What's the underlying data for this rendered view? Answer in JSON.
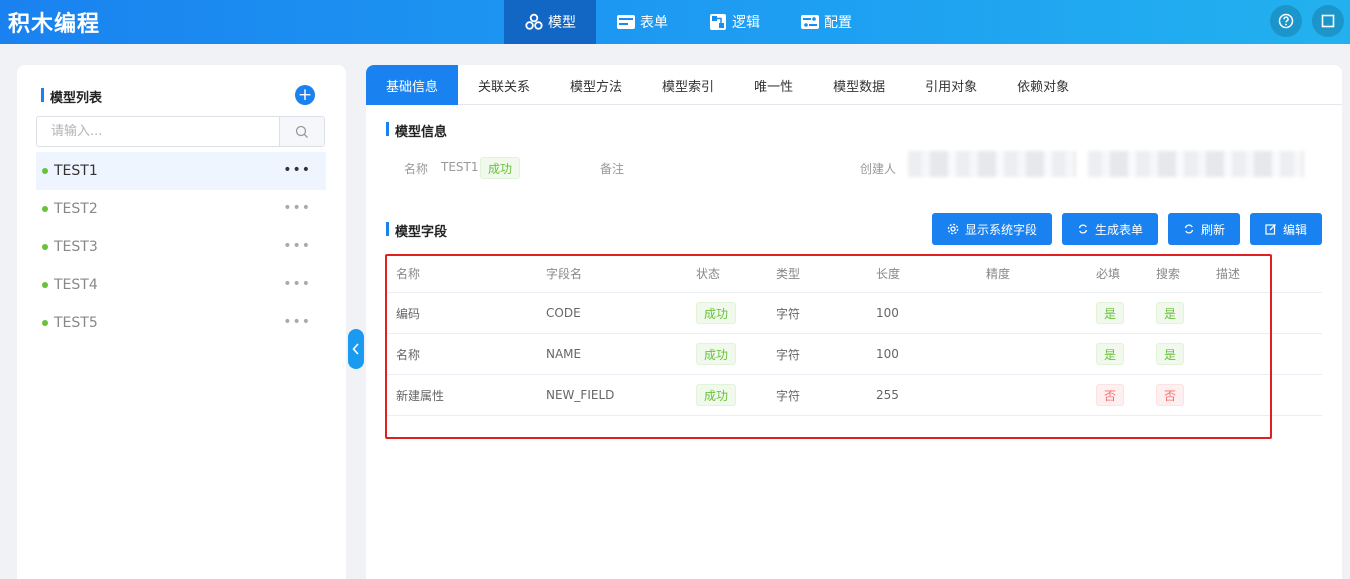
{
  "app": {
    "title": "积木编程"
  },
  "nav": [
    {
      "label": "模型",
      "icon": "cubes-icon",
      "active": true
    },
    {
      "label": "表单",
      "icon": "form-icon",
      "active": false
    },
    {
      "label": "逻辑",
      "icon": "logic-icon",
      "active": false
    },
    {
      "label": "配置",
      "icon": "config-icon",
      "active": false
    }
  ],
  "sidebar": {
    "title": "模型列表",
    "add_label": "+",
    "search_placeholder": "请输入...",
    "items": [
      {
        "name": "TEST1",
        "selected": true,
        "more": "•••"
      },
      {
        "name": "TEST2",
        "selected": false,
        "more": "•••"
      },
      {
        "name": "TEST3",
        "selected": false,
        "more": "•••"
      },
      {
        "name": "TEST4",
        "selected": false,
        "more": "•••"
      },
      {
        "name": "TEST5",
        "selected": false,
        "more": "•••"
      }
    ]
  },
  "tabs": [
    "基础信息",
    "关联关系",
    "模型方法",
    "模型索引",
    "唯一性",
    "模型数据",
    "引用对象",
    "依赖对象"
  ],
  "model_info": {
    "title": "模型信息",
    "name_label": "名称",
    "name_value": "TEST1",
    "status": "成功",
    "remark_label": "备注",
    "creator_label": "创建人"
  },
  "fields": {
    "title": "模型字段",
    "buttons": [
      "显示系统字段",
      "生成表单",
      "刷新",
      "编辑"
    ],
    "columns": [
      "名称",
      "字段名",
      "状态",
      "类型",
      "长度",
      "精度",
      "必填",
      "搜索",
      "描述"
    ],
    "rows": [
      {
        "name": "编码",
        "field": "CODE",
        "status": "成功",
        "type": "字符",
        "length": "100",
        "precision": "",
        "required": "是",
        "search": "是",
        "desc": ""
      },
      {
        "name": "名称",
        "field": "NAME",
        "status": "成功",
        "type": "字符",
        "length": "100",
        "precision": "",
        "required": "是",
        "search": "是",
        "desc": ""
      },
      {
        "name": "新建属性",
        "field": "NEW_FIELD",
        "status": "成功",
        "type": "字符",
        "length": "255",
        "precision": "",
        "required": "否",
        "search": "否",
        "desc": ""
      }
    ]
  },
  "colors": {
    "primary": "#1a82f0",
    "success": "#67c23a",
    "danger": "#f56c6c",
    "highlight": "#e02020"
  }
}
